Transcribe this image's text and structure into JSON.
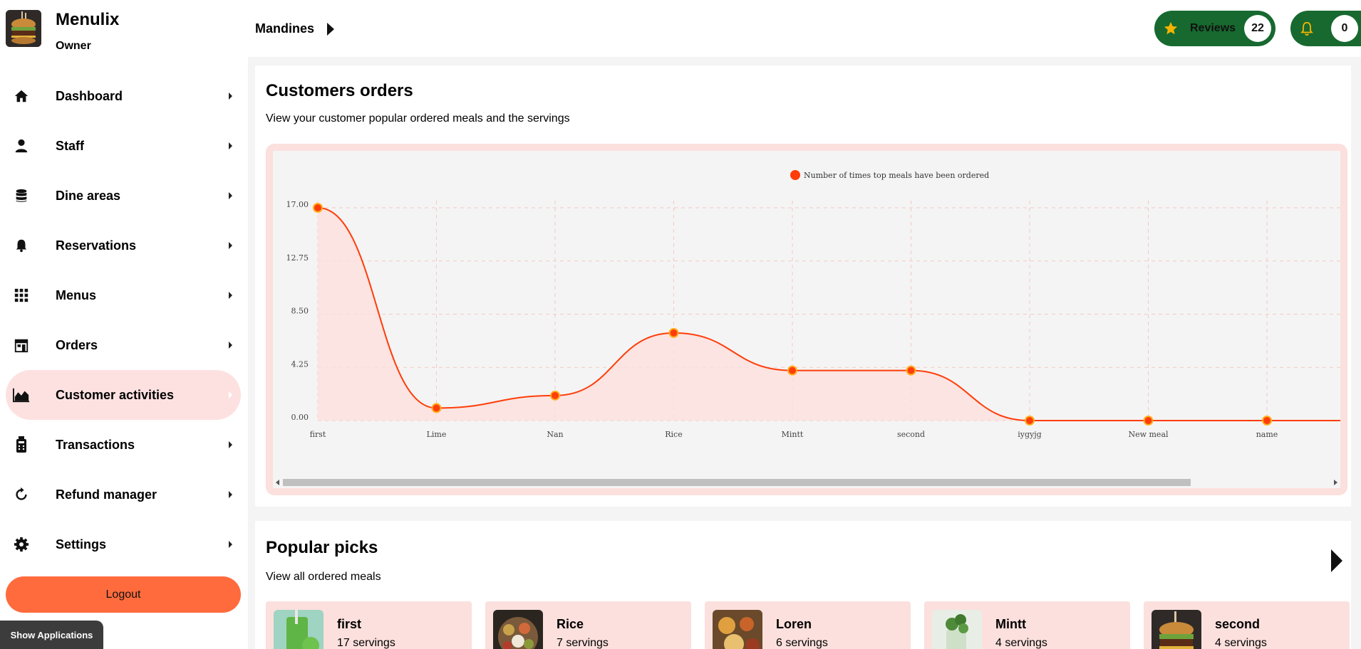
{
  "brand": {
    "name": "Menulix",
    "role": "Owner"
  },
  "sidebar": {
    "items": [
      {
        "label": "Dashboard",
        "icon": "home-icon",
        "active": false
      },
      {
        "label": "Staff",
        "icon": "person-icon",
        "active": false
      },
      {
        "label": "Dine areas",
        "icon": "database-icon",
        "active": false
      },
      {
        "label": "Reservations",
        "icon": "bell-icon",
        "active": false
      },
      {
        "label": "Menus",
        "icon": "grid-icon",
        "active": false
      },
      {
        "label": "Orders",
        "icon": "store-icon",
        "active": false
      },
      {
        "label": "Customer activities",
        "icon": "area-chart-icon",
        "active": true
      },
      {
        "label": "Transactions",
        "icon": "card-reader-icon",
        "active": false
      },
      {
        "label": "Refund manager",
        "icon": "refresh-icon",
        "active": false
      },
      {
        "label": "Settings",
        "icon": "gear-icon",
        "active": false
      }
    ],
    "logout_label": "Logout",
    "show_apps_label": "Show Applications"
  },
  "header": {
    "breadcrumb": "Mandines",
    "reviews_label": "Reviews",
    "reviews_count": "22",
    "notifications_count": "0"
  },
  "colors": {
    "accent": "#ff6b3d",
    "brand_green": "#17692f",
    "active_bg": "#fde1e1",
    "chart_line": "#ff3d0a",
    "chart_fill": "#fbe0dd"
  },
  "orders": {
    "title": "Customers orders",
    "subtitle": "View your customer popular ordered meals and the servings"
  },
  "chart_data": {
    "type": "area",
    "legend": "Number of times top meals have been ordered",
    "legend_position": "top-center",
    "categories": [
      "first",
      "Lime",
      "Nan",
      "Rice",
      "Mintt",
      "second",
      "iygyjg",
      "New meal",
      "name"
    ],
    "series": [
      {
        "name": "Number of times top meals have been ordered",
        "values": [
          17,
          1,
          2,
          7,
          4,
          4,
          0,
          0,
          0
        ]
      }
    ],
    "y_ticks": [
      "0.00",
      "4.25",
      "8.50",
      "12.75",
      "17.00"
    ],
    "ylim": [
      0,
      17
    ],
    "grid": true,
    "smooth": true
  },
  "picks": {
    "title": "Popular picks",
    "subtitle": "View all ordered meals",
    "items": [
      {
        "name": "first",
        "servings": "17 servings"
      },
      {
        "name": "Rice",
        "servings": "7 servings"
      },
      {
        "name": "Loren",
        "servings": "6 servings"
      },
      {
        "name": "Mintt",
        "servings": "4 servings"
      },
      {
        "name": "second",
        "servings": "4 servings"
      }
    ]
  }
}
